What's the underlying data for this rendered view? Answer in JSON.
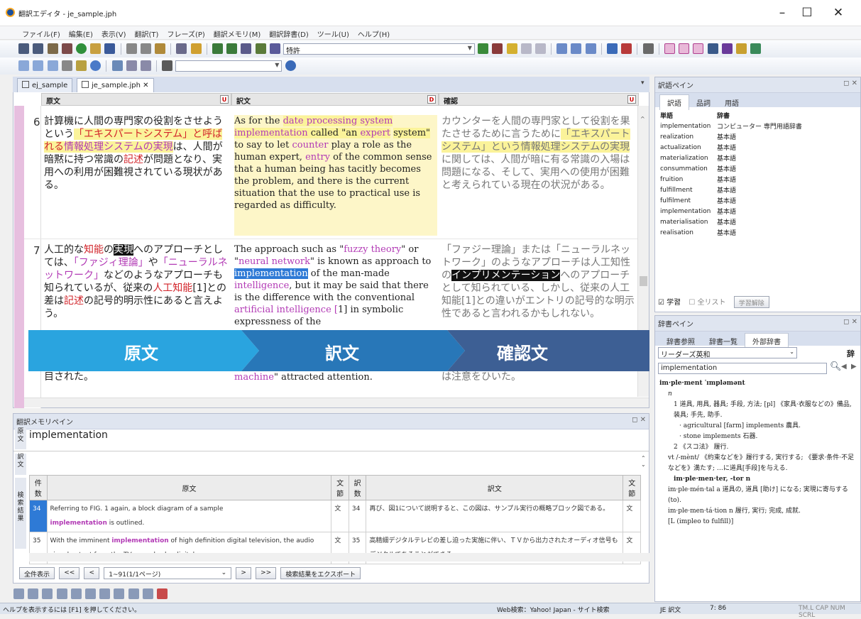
{
  "window": {
    "title": "翻訳エディタ - je_sample.jph",
    "minimize": "–",
    "maximize": "☐",
    "close": "✕"
  },
  "menu": [
    "ファイル(F)",
    "編集(E)",
    "表示(V)",
    "翻訳(T)",
    "フレーズ(P)",
    "翻訳メモリ(M)",
    "翻訳辞書(D)",
    "ツール(U)",
    "ヘルプ(H)"
  ],
  "toolbar": {
    "field_select": "特許",
    "sub_select": ""
  },
  "tabs": [
    {
      "label": "ej_sample"
    },
    {
      "label": "je_sample.jph",
      "close": "✕"
    }
  ],
  "columns": {
    "source": "原文",
    "translation": "訳文",
    "verify": "確認"
  },
  "rows": [
    {
      "num": "6"
    },
    {
      "num": "7"
    },
    {
      "num": "8"
    }
  ],
  "row6": {
    "src_a": "計算機に人間の専門家の役割をさせようという",
    "src_b": "「エキスパートシステム」と呼ばれる",
    "src_c": "情報処理システムの実現",
    "src_d": "は、人間が暗黙に持つ常識の",
    "src_e": "記述",
    "src_f": "が問題となり、実用への利用が困難視されている現状がある。",
    "tr_a": "As for the ",
    "tr_b": "date processing system",
    "tr_c": "implementation",
    "tr_d": " called \"an ",
    "tr_e": "expert",
    "tr_f": "system\"",
    "tr_g": " to say to let ",
    "tr_h": "counter",
    "tr_i": " play a role as the human expert, ",
    "tr_j": "entry",
    "tr_k": " of the common sense that a human being has tacitly becomes the problem, and there is the current situation that the use to practical use is regarded as difficulty.",
    "vf_a": "カウンターを人間の専門家として役割を果たさせるために言うために",
    "vf_b": "「エキスパートシステム」という情報処理システムの実現",
    "vf_c": "に関しては、人間が暗に有る常識の入場は問題になる、そして、実用への使用が困難と考えられている現在の状況がある。"
  },
  "row7": {
    "src_a": "人工的な",
    "src_b": "知能",
    "src_c": "の",
    "src_d": "実現",
    "src_e": "へのアプローチとしては、",
    "src_f": "「ファジィ理論」",
    "src_g": "や",
    "src_h": "「ニューラルネットワーク」",
    "src_i": "などのようなアプローチも知られているが、従来の",
    "src_j": "人工知能",
    "src_k": "[1]との差は",
    "src_l": "記述",
    "src_m": "の記号的明示性にあると言えよう。",
    "tr_a": "The approach such as \"",
    "tr_b": "fuzzy theory",
    "tr_c": "\" or \"",
    "tr_d": "neural network",
    "tr_e": "\" is known as approach to ",
    "tr_f": "implementation",
    "tr_g": " of the man-made ",
    "tr_h": "intelligence",
    "tr_i": ", but it may be said that there is the difference with the conventional ",
    "tr_j": "artificial intelligence",
    "tr_k": " [",
    "tr_l": "1] in symbolic expressness of the",
    "vf_a": "「ファジー理論」または「ニューラルネットワーク」のようなアプローチは人工知性の",
    "vf_b": "インプリメンテーション",
    "vf_c": "へのアプローチとして知られている、しかし、従来の人工知能[1]との違いがエントリの記号的な明示性であると言われるかもしれない。"
  },
  "row8": {
    "src": "目された。",
    "tr_a": "machine",
    "tr_b": "\" attracted attention.",
    "vf": "は注意をひいた。"
  },
  "banner": {
    "src": "原文",
    "tr": "訳文",
    "vf": "確認文"
  },
  "word_pane": {
    "title": "訳語ペイン",
    "tabs": [
      "訳語",
      "品詞",
      "用語"
    ],
    "headers": [
      "単語",
      "辞書"
    ],
    "items": [
      {
        "word": "implementation",
        "dict": "コンピューター 専門用語辞書"
      },
      {
        "word": "realization",
        "dict": "基本語"
      },
      {
        "word": "actualization",
        "dict": "基本語"
      },
      {
        "word": "materialization",
        "dict": "基本語"
      },
      {
        "word": "consummation",
        "dict": "基本語"
      },
      {
        "word": "fruition",
        "dict": "基本語"
      },
      {
        "word": "fulfillment",
        "dict": "基本語"
      },
      {
        "word": "fulfilment",
        "dict": "基本語"
      },
      {
        "word": "implementation",
        "dict": "基本語"
      },
      {
        "word": "materialisation",
        "dict": "基本語"
      },
      {
        "word": "realisation",
        "dict": "基本語"
      }
    ],
    "learn": "学習",
    "all_list": "全リスト",
    "learn_clear": "学習解除"
  },
  "dict_pane": {
    "title": "辞書ペイン",
    "tabs": [
      "辞書参照",
      "辞書一覧",
      "外部辞書"
    ],
    "dict_select": "リーダーズ英和",
    "lookup_label": "辞",
    "query": "implementation",
    "lines": [
      "im·ple·ment ˈɪmpləmənt",
      "n",
      "1 道具, 用具, 器具; 手段, 方法; [pl] 《家具·衣服などの》備品, 装具; 手先, 助手.",
      "· agricultural [farm] implements 農具.",
      "· stone implements 石器.",
      "2 《スコ法》 履行.",
      "vt /-mènt/ 《約束などを》履行する, 実行する; 《要求·条件·不足などを》満たす; …に道具[手段]を与える.",
      "im·ple·men·ter, -tor n",
      "im·ple·mén·tal a 道具の, 道具 [助け] になる; 実現に寄与する (to).",
      "im·ple·men·tá·tion n 履行, 実行; 完成, 成就.",
      "[L (impleo to fulfill)]"
    ]
  },
  "memory_pane": {
    "title": "翻訳メモリペイン",
    "src_label": "原文",
    "tr_label": "訳文",
    "results_label": "検索結果",
    "query": "implementation",
    "headers": [
      "件数",
      "原文",
      "文節",
      "訳数",
      "訳文",
      "文節"
    ],
    "results": [
      {
        "id": "34",
        "src_a": "Referring to FIG. 1 again, a block diagram of a sample",
        "src_b": "implementation",
        "src_c": " is outlined.",
        "type": "文",
        "num": "34",
        "tr": "再び、図1について説明すると、この図は、サンプル実行の概略ブロック図である。",
        "type2": "文"
      },
      {
        "id": "35",
        "src_a": "With the imminent ",
        "src_b": "implementation",
        "src_c": " of high definition digital television, the audio signal output from the TV may also be digital.",
        "type": "文",
        "num": "35",
        "tr": "高精細デジタルテレビの差し迫った実施に伴い、ＴＶから出力されたオーディオ信号もデジタルであることができる。",
        "type2": "文"
      }
    ],
    "btn_all": "全件表示",
    "btn_first": "<<",
    "btn_prev": "<",
    "page_select": "1~91(1/1ページ)",
    "btn_next": ">",
    "btn_last": ">>",
    "btn_export": "検索結果をエクスポート"
  },
  "status": {
    "help": "ヘルプを表示するには [F1] を押してください。",
    "web": "Web検索：Yahoo! Japan - サイト検索",
    "mode": "JE 訳文",
    "pos": "7: 86",
    "keys": "TM.L CAP NUM SCRL"
  },
  "colors": {
    "accent": "#2e7ad6",
    "banner_left": "#2aa4df",
    "banner_mid": "#2877b8",
    "banner_right": "#3d5f94",
    "highlight": "#fbf39a",
    "magenta": "#b23ab5"
  }
}
